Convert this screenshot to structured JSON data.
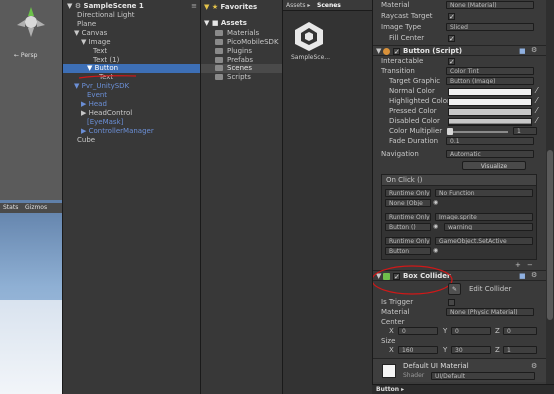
{
  "scene_view": {
    "persp_label": "← Persp"
  },
  "game_view": {
    "stats_label": "Stats",
    "gizmos_label": "Gizmos"
  },
  "hierarchy": {
    "scene_name": "SampleScene 1",
    "items": [
      {
        "label": "Directional Light"
      },
      {
        "label": "Plane"
      },
      {
        "label": "▼ Canvas"
      },
      {
        "label": "▼ Image"
      },
      {
        "label": "Text"
      },
      {
        "label": "Text (1)"
      },
      {
        "label": "▼ Button"
      },
      {
        "label": "Text"
      },
      {
        "label": "▼ Pvr_UnitySDK"
      },
      {
        "label": "Event"
      },
      {
        "label": "▶ Head"
      },
      {
        "label": "▶ HeadControl"
      },
      {
        "label": "[EyeMask]"
      },
      {
        "label": "▶ ControllerManager"
      },
      {
        "label": "Cube"
      }
    ]
  },
  "project": {
    "favorites_label": "Favorites",
    "assets_label": "Assets",
    "folders": [
      {
        "label": "Materials"
      },
      {
        "label": "PicoMobileSDK"
      },
      {
        "label": "Plugins"
      },
      {
        "label": "Prefabs"
      },
      {
        "label": "Scenes"
      },
      {
        "label": "Scripts"
      }
    ],
    "breadcrumb_root": "Assets ▸",
    "breadcrumb_current": "Scenes",
    "asset_name": "SampleSce..."
  },
  "inspector": {
    "top_rows": [
      {
        "label": "Material",
        "value": "None (Material)"
      },
      {
        "label": "Raycast Target",
        "value": "✓"
      },
      {
        "label": "Image Type",
        "value": "Sliced"
      },
      {
        "label": "Fill Center",
        "value": "✓"
      }
    ],
    "button_header": "Button (Script)",
    "interactable_label": "Interactable",
    "interactable_value": "✓",
    "transition_label": "Transition",
    "transition_value": "Color Tint",
    "target_graphic_label": "Target Graphic",
    "target_graphic_value": "Button (Image)",
    "colors": [
      {
        "label": "Normal Color"
      },
      {
        "label": "Highlighted Color"
      },
      {
        "label": "Pressed Color"
      },
      {
        "label": "Disabled Color"
      }
    ],
    "color_multiplier_label": "Color Multiplier",
    "color_multiplier_value": "1",
    "fade_duration_label": "Fade Duration",
    "fade_duration_value": "0.1",
    "navigation_label": "Navigation",
    "navigation_value": "Automatic",
    "visualize_label": "Visualize",
    "onclick_label": "On Click ()",
    "events": [
      {
        "runtime": "Runtime Only",
        "function": "No Function",
        "object": "None (Obje"
      },
      {
        "runtime": "Runtime Only",
        "function": "Image.sprite",
        "object": "Button ()",
        "arg": "warning"
      },
      {
        "runtime": "Runtime Only",
        "function": "GameObject.SetActive",
        "object": "Button"
      }
    ],
    "box_collider_header": "Box Collider",
    "edit_collider_label": "Edit Collider",
    "is_trigger_label": "Is Trigger",
    "material_label": "Material",
    "material_value": "None (Physic Material)",
    "center_label": "Center",
    "center": {
      "x": "0",
      "y": "0",
      "z": "0"
    },
    "size_label": "Size",
    "size": {
      "x": "160",
      "y": "30",
      "z": "1"
    },
    "default_material_label": "Default UI Material",
    "shader_label": "Shader",
    "shader_value": "UI/Default"
  },
  "bottom_bar": {
    "selected_label": "Button ▸"
  },
  "colors": {
    "accent_blue": "#3d6fb6",
    "link_blue": "#6b8fd6",
    "annotation_red": "#d01818"
  }
}
